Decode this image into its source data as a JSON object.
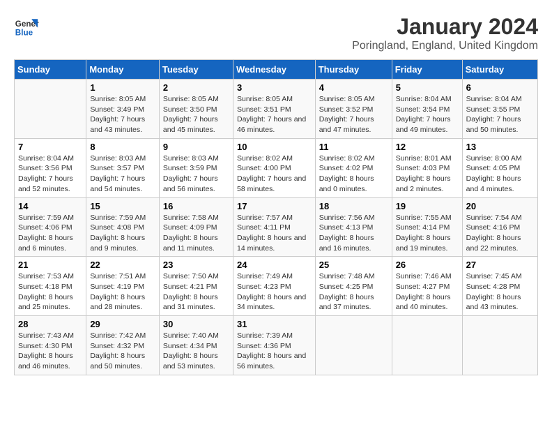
{
  "logo": {
    "line1": "General",
    "line2": "Blue"
  },
  "title": "January 2024",
  "subtitle": "Poringland, England, United Kingdom",
  "colors": {
    "header_bg": "#1565c0",
    "header_text": "#ffffff"
  },
  "weekdays": [
    "Sunday",
    "Monday",
    "Tuesday",
    "Wednesday",
    "Thursday",
    "Friday",
    "Saturday"
  ],
  "weeks": [
    [
      {
        "day": "",
        "sunrise": "",
        "sunset": "",
        "daylight": ""
      },
      {
        "day": "1",
        "sunrise": "Sunrise: 8:05 AM",
        "sunset": "Sunset: 3:49 PM",
        "daylight": "Daylight: 7 hours and 43 minutes."
      },
      {
        "day": "2",
        "sunrise": "Sunrise: 8:05 AM",
        "sunset": "Sunset: 3:50 PM",
        "daylight": "Daylight: 7 hours and 45 minutes."
      },
      {
        "day": "3",
        "sunrise": "Sunrise: 8:05 AM",
        "sunset": "Sunset: 3:51 PM",
        "daylight": "Daylight: 7 hours and 46 minutes."
      },
      {
        "day": "4",
        "sunrise": "Sunrise: 8:05 AM",
        "sunset": "Sunset: 3:52 PM",
        "daylight": "Daylight: 7 hours and 47 minutes."
      },
      {
        "day": "5",
        "sunrise": "Sunrise: 8:04 AM",
        "sunset": "Sunset: 3:54 PM",
        "daylight": "Daylight: 7 hours and 49 minutes."
      },
      {
        "day": "6",
        "sunrise": "Sunrise: 8:04 AM",
        "sunset": "Sunset: 3:55 PM",
        "daylight": "Daylight: 7 hours and 50 minutes."
      }
    ],
    [
      {
        "day": "7",
        "sunrise": "Sunrise: 8:04 AM",
        "sunset": "Sunset: 3:56 PM",
        "daylight": "Daylight: 7 hours and 52 minutes."
      },
      {
        "day": "8",
        "sunrise": "Sunrise: 8:03 AM",
        "sunset": "Sunset: 3:57 PM",
        "daylight": "Daylight: 7 hours and 54 minutes."
      },
      {
        "day": "9",
        "sunrise": "Sunrise: 8:03 AM",
        "sunset": "Sunset: 3:59 PM",
        "daylight": "Daylight: 7 hours and 56 minutes."
      },
      {
        "day": "10",
        "sunrise": "Sunrise: 8:02 AM",
        "sunset": "Sunset: 4:00 PM",
        "daylight": "Daylight: 7 hours and 58 minutes."
      },
      {
        "day": "11",
        "sunrise": "Sunrise: 8:02 AM",
        "sunset": "Sunset: 4:02 PM",
        "daylight": "Daylight: 8 hours and 0 minutes."
      },
      {
        "day": "12",
        "sunrise": "Sunrise: 8:01 AM",
        "sunset": "Sunset: 4:03 PM",
        "daylight": "Daylight: 8 hours and 2 minutes."
      },
      {
        "day": "13",
        "sunrise": "Sunrise: 8:00 AM",
        "sunset": "Sunset: 4:05 PM",
        "daylight": "Daylight: 8 hours and 4 minutes."
      }
    ],
    [
      {
        "day": "14",
        "sunrise": "Sunrise: 7:59 AM",
        "sunset": "Sunset: 4:06 PM",
        "daylight": "Daylight: 8 hours and 6 minutes."
      },
      {
        "day": "15",
        "sunrise": "Sunrise: 7:59 AM",
        "sunset": "Sunset: 4:08 PM",
        "daylight": "Daylight: 8 hours and 9 minutes."
      },
      {
        "day": "16",
        "sunrise": "Sunrise: 7:58 AM",
        "sunset": "Sunset: 4:09 PM",
        "daylight": "Daylight: 8 hours and 11 minutes."
      },
      {
        "day": "17",
        "sunrise": "Sunrise: 7:57 AM",
        "sunset": "Sunset: 4:11 PM",
        "daylight": "Daylight: 8 hours and 14 minutes."
      },
      {
        "day": "18",
        "sunrise": "Sunrise: 7:56 AM",
        "sunset": "Sunset: 4:13 PM",
        "daylight": "Daylight: 8 hours and 16 minutes."
      },
      {
        "day": "19",
        "sunrise": "Sunrise: 7:55 AM",
        "sunset": "Sunset: 4:14 PM",
        "daylight": "Daylight: 8 hours and 19 minutes."
      },
      {
        "day": "20",
        "sunrise": "Sunrise: 7:54 AM",
        "sunset": "Sunset: 4:16 PM",
        "daylight": "Daylight: 8 hours and 22 minutes."
      }
    ],
    [
      {
        "day": "21",
        "sunrise": "Sunrise: 7:53 AM",
        "sunset": "Sunset: 4:18 PM",
        "daylight": "Daylight: 8 hours and 25 minutes."
      },
      {
        "day": "22",
        "sunrise": "Sunrise: 7:51 AM",
        "sunset": "Sunset: 4:19 PM",
        "daylight": "Daylight: 8 hours and 28 minutes."
      },
      {
        "day": "23",
        "sunrise": "Sunrise: 7:50 AM",
        "sunset": "Sunset: 4:21 PM",
        "daylight": "Daylight: 8 hours and 31 minutes."
      },
      {
        "day": "24",
        "sunrise": "Sunrise: 7:49 AM",
        "sunset": "Sunset: 4:23 PM",
        "daylight": "Daylight: 8 hours and 34 minutes."
      },
      {
        "day": "25",
        "sunrise": "Sunrise: 7:48 AM",
        "sunset": "Sunset: 4:25 PM",
        "daylight": "Daylight: 8 hours and 37 minutes."
      },
      {
        "day": "26",
        "sunrise": "Sunrise: 7:46 AM",
        "sunset": "Sunset: 4:27 PM",
        "daylight": "Daylight: 8 hours and 40 minutes."
      },
      {
        "day": "27",
        "sunrise": "Sunrise: 7:45 AM",
        "sunset": "Sunset: 4:28 PM",
        "daylight": "Daylight: 8 hours and 43 minutes."
      }
    ],
    [
      {
        "day": "28",
        "sunrise": "Sunrise: 7:43 AM",
        "sunset": "Sunset: 4:30 PM",
        "daylight": "Daylight: 8 hours and 46 minutes."
      },
      {
        "day": "29",
        "sunrise": "Sunrise: 7:42 AM",
        "sunset": "Sunset: 4:32 PM",
        "daylight": "Daylight: 8 hours and 50 minutes."
      },
      {
        "day": "30",
        "sunrise": "Sunrise: 7:40 AM",
        "sunset": "Sunset: 4:34 PM",
        "daylight": "Daylight: 8 hours and 53 minutes."
      },
      {
        "day": "31",
        "sunrise": "Sunrise: 7:39 AM",
        "sunset": "Sunset: 4:36 PM",
        "daylight": "Daylight: 8 hours and 56 minutes."
      },
      {
        "day": "",
        "sunrise": "",
        "sunset": "",
        "daylight": ""
      },
      {
        "day": "",
        "sunrise": "",
        "sunset": "",
        "daylight": ""
      },
      {
        "day": "",
        "sunrise": "",
        "sunset": "",
        "daylight": ""
      }
    ]
  ]
}
